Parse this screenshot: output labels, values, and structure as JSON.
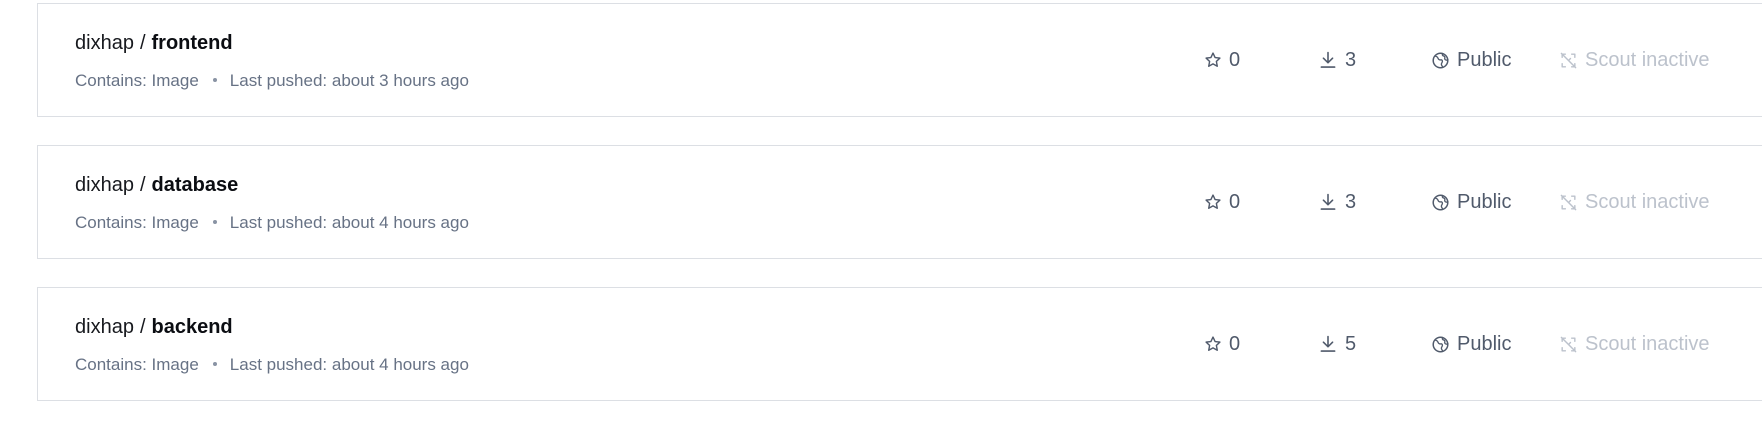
{
  "repositories": [
    {
      "namespace": "dixhap",
      "separator": "/",
      "name": "frontend",
      "contains": "Contains: Image",
      "last_pushed": "Last pushed: about 3 hours ago",
      "stars": "0",
      "pulls": "3",
      "visibility": "Public",
      "scout_status": "Scout inactive"
    },
    {
      "namespace": "dixhap",
      "separator": "/",
      "name": "database",
      "contains": "Contains: Image",
      "last_pushed": "Last pushed: about 4 hours ago",
      "stars": "0",
      "pulls": "3",
      "visibility": "Public",
      "scout_status": "Scout inactive"
    },
    {
      "namespace": "dixhap",
      "separator": "/",
      "name": "backend",
      "contains": "Contains: Image",
      "last_pushed": "Last pushed: about 4 hours ago",
      "stars": "0",
      "pulls": "5",
      "visibility": "Public",
      "scout_status": "Scout inactive"
    }
  ],
  "icons": {
    "stars": "star-icon",
    "pulls": "download-icon",
    "visibility": "public-globe-icon",
    "scout": "scout-inactive-icon"
  },
  "colors": {
    "card_border": "#dcdfe4",
    "primary_text": "#17191e",
    "secondary_text": "#677285",
    "stat_text": "#505a6b",
    "inactive_text": "#bcc2cc"
  }
}
